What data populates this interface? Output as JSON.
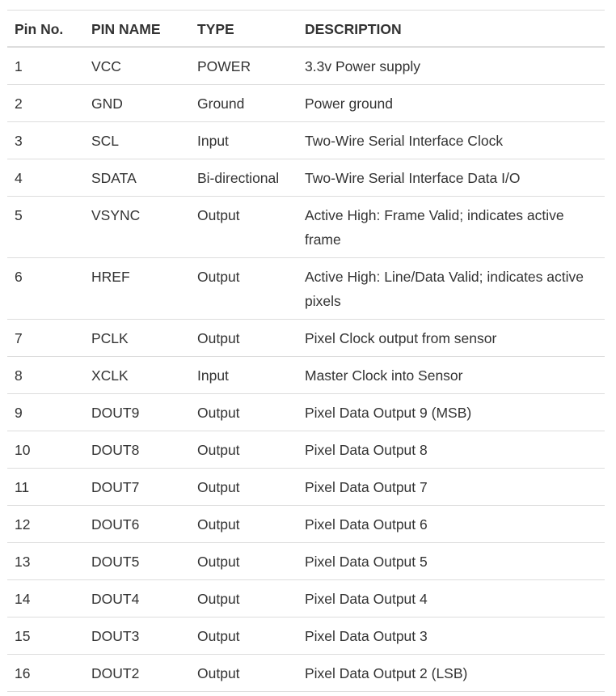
{
  "headers": [
    "Pin No.",
    "PIN NAME",
    "TYPE",
    "DESCRIPTION"
  ],
  "rows": [
    [
      "1",
      "VCC",
      "POWER",
      "3.3v Power supply"
    ],
    [
      "2",
      "GND",
      "Ground",
      "Power ground"
    ],
    [
      "3",
      "SCL",
      "Input",
      "Two-Wire Serial Interface Clock"
    ],
    [
      "4",
      "SDATA",
      "Bi-directional",
      "Two-Wire Serial Interface Data I/O"
    ],
    [
      "5",
      "VSYNC",
      "Output",
      "Active High: Frame Valid; indicates active frame"
    ],
    [
      "6",
      "HREF",
      "Output",
      "Active High: Line/Data Valid; indicates active pixels"
    ],
    [
      "7",
      "PCLK",
      "Output",
      "Pixel Clock output from sensor"
    ],
    [
      "8",
      "XCLK",
      "Input",
      "Master Clock into Sensor"
    ],
    [
      "9",
      "DOUT9",
      "Output",
      "Pixel Data Output 9 (MSB)"
    ],
    [
      "10",
      "DOUT8",
      "Output",
      "Pixel Data Output 8"
    ],
    [
      "11",
      "DOUT7",
      "Output",
      "Pixel Data Output 7"
    ],
    [
      "12",
      "DOUT6",
      "Output",
      "Pixel Data Output 6"
    ],
    [
      "13",
      "DOUT5",
      "Output",
      "Pixel Data Output 5"
    ],
    [
      "14",
      "DOUT4",
      "Output",
      "Pixel Data Output 4"
    ],
    [
      "15",
      "DOUT3",
      "Output",
      "Pixel Data Output 3"
    ],
    [
      "16",
      "DOUT2",
      "Output",
      "Pixel Data Output 2 (LSB)"
    ]
  ]
}
